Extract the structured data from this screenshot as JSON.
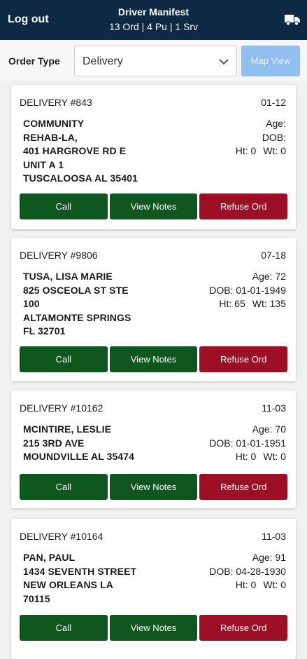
{
  "header": {
    "logout_label": "Log out",
    "title": "Driver Manifest",
    "subtitle": "13 Ord | 4 Pu | 1 Srv",
    "icon": "truck-icon"
  },
  "filter": {
    "label": "Order Type",
    "selected": "Delivery",
    "map_button": "Map View"
  },
  "colors": {
    "header_bg": "#0e2944",
    "call": "#10561f",
    "view_notes": "#10561f",
    "refuse": "#9c0f25",
    "map_view_disabled": "#93bef0"
  },
  "orders": [
    {
      "title": "DELIVERY #843",
      "date": "01-12",
      "address": [
        "COMMUNITY",
        "REHAB-LA,",
        "401 HARGROVE RD E",
        "UNIT A 1",
        "TUSCALOOSA AL 35401"
      ],
      "age": "Age:",
      "dob": "DOB:",
      "ht": "Ht: 0",
      "wt": "Wt: 0",
      "call": "Call",
      "notes": "View Notes",
      "refuse": "Refuse Ord"
    },
    {
      "title": "DELIVERY #9806",
      "date": "07-18",
      "address": [
        "TUSA, LISA MARIE",
        "825 OSCEOLA ST STE",
        "100",
        "ALTAMONTE SPRINGS",
        "FL 32701"
      ],
      "age": "Age: 72",
      "dob": "DOB: 01-01-1949",
      "ht": "Ht: 65",
      "wt": "Wt: 135",
      "call": "Call",
      "notes": "View Notes",
      "refuse": "Refuse Ord"
    },
    {
      "title": "DELIVERY #10162",
      "date": "11-03",
      "address": [
        "MCINTIRE, LESLIE",
        "215 3RD AVE",
        "MOUNDVILLE AL 35474"
      ],
      "age": "Age: 70",
      "dob": "DOB: 01-01-1951",
      "ht": "Ht: 0",
      "wt": "Wt: 0",
      "call": "Call",
      "notes": "View Notes",
      "refuse": "Refuse Ord"
    },
    {
      "title": "DELIVERY #10164",
      "date": "11-03",
      "address": [
        "PAN, PAUL",
        "1434 SEVENTH STREET",
        "NEW ORLEANS LA",
        "70115"
      ],
      "age": "Age: 91",
      "dob": "DOB: 04-28-1930",
      "ht": "Ht: 0",
      "wt": "Wt: 0",
      "call": "Call",
      "notes": "View Notes",
      "refuse": "Refuse Ord"
    }
  ]
}
